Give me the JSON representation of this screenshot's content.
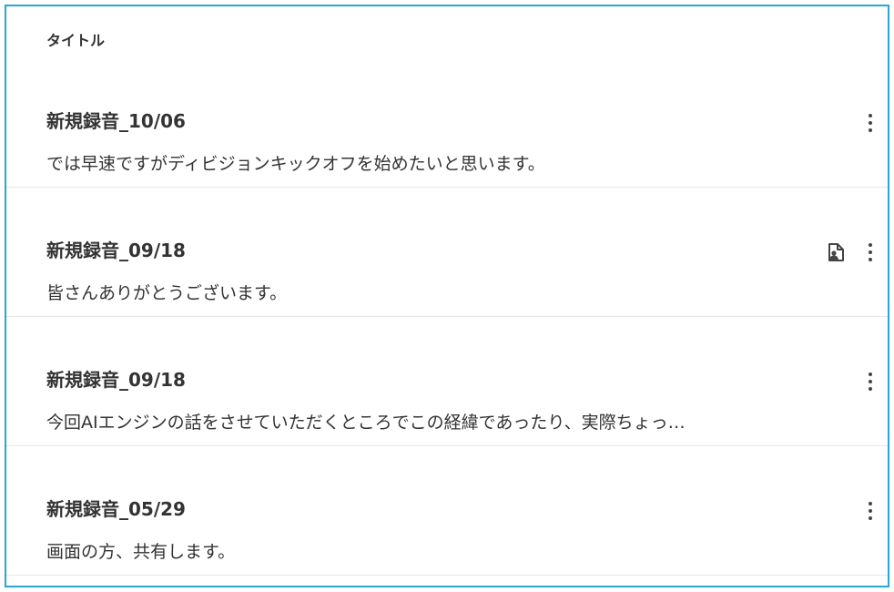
{
  "header": {
    "title": "タイトル"
  },
  "recordings": [
    {
      "title": "新規録音_10/06",
      "preview": "では早速ですがディビジョンキックオフを始めたいと思います。",
      "has_transcript_icon": false
    },
    {
      "title": "新規録音_09/18",
      "preview": "皆さんありがとうございます。",
      "has_transcript_icon": true
    },
    {
      "title": "新規録音_09/18",
      "preview": "今回AIエンジンの話をさせていただくところでこの経緯であったり、実際ちょっ…",
      "has_transcript_icon": false
    },
    {
      "title": "新規録音_05/29",
      "preview": "画面の方、共有します。",
      "has_transcript_icon": false
    }
  ],
  "icons": {
    "more": "more-vertical-icon",
    "transcript": "speaker-document-icon"
  },
  "colors": {
    "frame_border": "#2aa6d6",
    "text": "#333333",
    "divider": "#e4e6ea"
  }
}
